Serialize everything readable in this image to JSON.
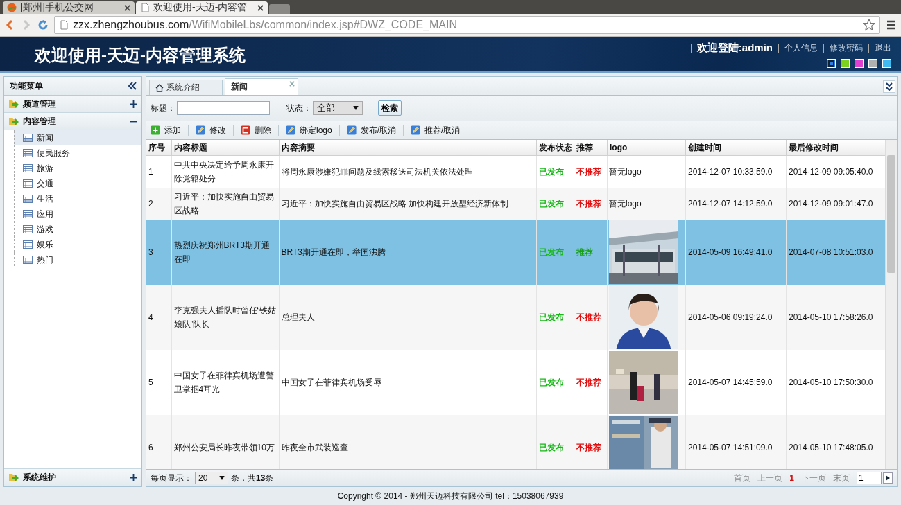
{
  "browser": {
    "tabs": [
      {
        "title": "[郑州]手机公交网",
        "selected": false,
        "kind": "site"
      },
      {
        "title": "欢迎使用-天迈-内容管",
        "selected": true,
        "kind": "page"
      }
    ],
    "url": {
      "host": "zzx.zhengzhoubus.com",
      "path": "/WifiMobileLbs/common/index.jsp#DWZ_CODE_MAIN"
    }
  },
  "header": {
    "title": "欢迎使用-天迈-内容管理系统",
    "greeting": "欢迎登陆:admin",
    "links": [
      "个人信息",
      "修改密码",
      "退出"
    ],
    "themes": [
      {
        "color": "#2d7ee0",
        "selected": true
      },
      {
        "color": "#7dd11f",
        "selected": false
      },
      {
        "color": "#e040d0",
        "selected": false
      },
      {
        "color": "#b0b0b0",
        "selected": false
      },
      {
        "color": "#40b8f0",
        "selected": false
      }
    ]
  },
  "sidebar": {
    "title": "功能菜单",
    "sections": [
      {
        "label": "频道管理",
        "expanded": false
      },
      {
        "label": "内容管理",
        "expanded": true,
        "children": [
          {
            "label": "新闻",
            "selected": true
          },
          {
            "label": "便民服务",
            "selected": false
          },
          {
            "label": "旅游",
            "selected": false
          },
          {
            "label": "交通",
            "selected": false
          },
          {
            "label": "生活",
            "selected": false
          },
          {
            "label": "应用",
            "selected": false
          },
          {
            "label": "游戏",
            "selected": false
          },
          {
            "label": "娱乐",
            "selected": false
          },
          {
            "label": "热门",
            "selected": false
          }
        ]
      },
      {
        "label": "系统维护",
        "expanded": false
      }
    ]
  },
  "tabs": [
    {
      "label": "系统介绍",
      "selected": false,
      "kind": "home"
    },
    {
      "label": "新闻",
      "selected": true,
      "kind": "closable"
    }
  ],
  "search": {
    "title_label": "标题：",
    "status_label": "状态：",
    "status_value": "全部",
    "button": "检索"
  },
  "toolbar": [
    {
      "label": "添加",
      "kind": "add"
    },
    {
      "label": "修改",
      "kind": "edit"
    },
    {
      "label": "删除",
      "kind": "delete"
    },
    {
      "label": "绑定logo",
      "kind": "edit"
    },
    {
      "label": "发布/取消",
      "kind": "edit"
    },
    {
      "label": "推荐/取消",
      "kind": "edit"
    }
  ],
  "table": {
    "columns": [
      "序号",
      "内容标题",
      "内容摘要",
      "发布状态",
      "推荐",
      "logo",
      "创建时间",
      "最后修改时间"
    ],
    "rows": [
      {
        "index": "1",
        "title": "中共中央决定给予周永康开除党籍处分",
        "summary": "将周永康涉嫌犯罪问题及线索移送司法机关依法处理",
        "status": "已发布",
        "recommend": "不推荐",
        "recommended": false,
        "logo": "暂无logo",
        "created": "2014-12-07 10:33:59.0",
        "modified": "2014-12-09 09:05:40.0",
        "selected": false
      },
      {
        "index": "2",
        "title": "习近平：加快实施自由贸易区战略",
        "summary": "习近平：加快实施自由贸易区战略 加快构建开放型经济新体制",
        "status": "已发布",
        "recommend": "不推荐",
        "recommended": false,
        "logo": "暂无logo",
        "created": "2014-12-07 14:12:59.0",
        "modified": "2014-12-09 09:01:47.0",
        "selected": false
      },
      {
        "index": "3",
        "title": "热烈庆祝郑州BRT3期开通在即",
        "summary": "BRT3期开通在即，举国沸腾",
        "status": "已发布",
        "recommend": "推荐",
        "recommended": true,
        "kind": "picture",
        "created": "2014-05-09 16:49:41.0",
        "modified": "2014-07-08 10:51:03.0",
        "selected": true
      },
      {
        "index": "4",
        "title": "李克强夫人插队时曾任“铁姑娘队”队长",
        "summary": "总理夫人",
        "status": "已发布",
        "recommend": "不推荐",
        "recommended": false,
        "kind": "picture",
        "created": "2014-05-06 09:19:24.0",
        "modified": "2014-05-10 17:58:26.0",
        "selected": false
      },
      {
        "index": "5",
        "title": "中国女子在菲律宾机场遭警卫掌掴4耳光",
        "summary": "中国女子在菲律宾机场受辱",
        "status": "已发布",
        "recommend": "不推荐",
        "recommended": false,
        "kind": "picture",
        "created": "2014-05-07 14:45:59.0",
        "modified": "2014-05-10 17:50:30.0",
        "selected": false
      },
      {
        "index": "6",
        "title": "郑州公安局长昨夜带领10万",
        "summary": "昨夜全市武装巡查",
        "status": "已发布",
        "recommend": "不推荐",
        "recommended": false,
        "kind": "picture",
        "created": "2014-05-07 14:51:09.0",
        "modified": "2014-05-10 17:48:05.0",
        "selected": false
      }
    ]
  },
  "pager": {
    "label": "每页显示：",
    "value": "20",
    "total": "条，共**13**条",
    "first": "首页",
    "prev": "上一页",
    "current": "1",
    "next": "下一页",
    "last": "末页",
    "page_input": "1"
  },
  "footer": "Copyright © 2014 - 郑州天迈科技有限公司 tel：15038067939"
}
